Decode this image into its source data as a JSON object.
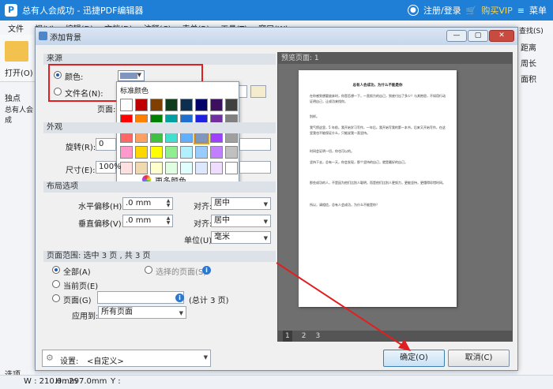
{
  "app": {
    "logo": "P",
    "title": "总有人会成功 - 迅捷PDF编辑器",
    "login": "注册/登录",
    "vip": "购买VIP",
    "menu": "菜单"
  },
  "menubar": [
    "文件",
    "视(V)",
    "编辑(D)",
    "文档(D)",
    "注释(C)",
    "表单(R)",
    "工具(T)",
    "窗口(W)"
  ],
  "toolbar": {
    "open": "打开(O)",
    "tab_doc": "总有人会成"
  },
  "right_side": {
    "search": "查找(S)",
    "distance": "距离",
    "perimeter": "周长",
    "area": "面积"
  },
  "left_tabs": {
    "tab1": "独点",
    "tab2": "选项"
  },
  "statusbar": {
    "w": "W : 210.0mm",
    "h": "H : 297.0mm",
    "y": "Y :"
  },
  "dialog": {
    "title": "添加背景",
    "win_buttons": [
      "—",
      "▢",
      "✕"
    ],
    "source": {
      "header": "来源",
      "color_label": "颜色:",
      "file_label": "文件名(N):",
      "page_label": "页面:",
      "swatch_color": "#7f97bf"
    },
    "palette": {
      "header": "标准颜色",
      "more": "更多颜色...",
      "rows": [
        [
          "#ffffff",
          "#c00000",
          "#7f3f00",
          "#0f3c1a",
          "#0d2f4f",
          "#00006a",
          "#3c0f5f",
          "#404040"
        ],
        [
          "#ff0000",
          "#ff7f00",
          "#008000",
          "#00a0a0",
          "#1f6fd0",
          "#2020e0",
          "#7030a0",
          "#808080"
        ],
        [
          "#ff6666",
          "#ffa060",
          "#40c040",
          "#40e0d0",
          "#60b0ff",
          "#7f97bf",
          "#a040ff",
          "#a0a0a0"
        ],
        [
          "#ff99cc",
          "#ffd700",
          "#ffff00",
          "#90ee90",
          "#b0f0ff",
          "#99ccff",
          "#c080ff",
          "#c0c0c0"
        ],
        [
          "#ffe0e0",
          "#f0d8b0",
          "#ffffcc",
          "#e0ffe0",
          "#e0ffff",
          "#dde8ff",
          "#eeddff",
          "#ffffff"
        ]
      ],
      "selected": [
        2,
        5
      ]
    },
    "appearance": {
      "header": "外观",
      "rotation_label": "旋转(R):",
      "rotation_value": "0",
      "size_label": "尺寸(E):",
      "size_value": "100%"
    },
    "layout": {
      "header": "布局选项",
      "hoffset_label": "水平偏移(H):",
      "hoffset_value": ".0 mm",
      "voffset_label": "垂直偏移(V):",
      "voffset_value": ".0 mm",
      "align1_label": "对齐:",
      "align1_value": "居中",
      "align2_label": "对齐:",
      "align2_value": "居中",
      "unit_label": "单位(U):",
      "unit_value": "毫米"
    },
    "range": {
      "header": "页面范围: 选中 3 页 , 共 3 页",
      "all": "全部(A)",
      "selected": "选择的页面(S)",
      "current": "当前页(E)",
      "pages": "页面(G)",
      "total": "(总计 3 页)",
      "apply_label": "应用到:",
      "apply_value": "所有页面"
    },
    "preview": {
      "header": "预览页面: 1",
      "doc_title": "总有人会成功，为什么不能是你",
      "paragraphs": [
        "在你感到想要放弃时，你是否想一下，一直努力的自己，到底付出了多少？与其抱怨，不如用行动证明自己，让成功来找你。",
        "别样。",
        "我气愤这里，5 年前，我开始学习写作，一年后，我开始写我的第一本书，后来又开始写作，在这里我也不能保证什么，只能说我一直坚持。",
        "时间会证明一切，你也可以的。",
        "坚持下去，总有一天，你会发现，那个坚持的自己，就是最好的自己。",
        "那些成功的人，不是因为他们比别人聪明，而是他们比别人更努力，更能坚持，更懂得珍惜时间。",
        "所以，请相信，总有人会成功，为什么不能是你？"
      ],
      "pages": [
        "1",
        "2",
        "3"
      ]
    },
    "settings_label": "设置:",
    "settings_value": "<自定义>",
    "ok": "确定(O)",
    "cancel": "取消(C)"
  }
}
